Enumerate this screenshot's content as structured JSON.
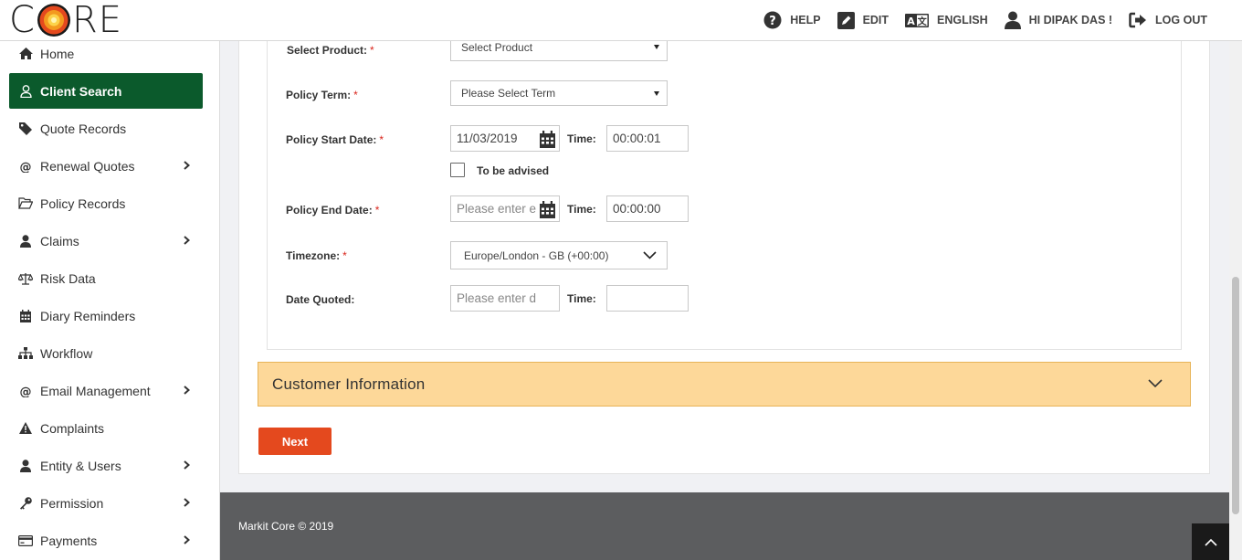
{
  "logo": {
    "letters": [
      "C",
      "R",
      "E"
    ]
  },
  "top_nav": [
    {
      "label": "HELP",
      "icon": "help-icon"
    },
    {
      "label": "EDIT",
      "icon": "edit-icon"
    },
    {
      "label": "ENGLISH",
      "icon": "translate-icon"
    },
    {
      "label": "HI DIPAK DAS !",
      "icon": "user-icon"
    },
    {
      "label": "LOG OUT",
      "icon": "logout-icon"
    }
  ],
  "sidebar": {
    "items": [
      {
        "label": "Home",
        "icon": "home-icon",
        "has_submenu": false
      },
      {
        "label": "Client Search",
        "icon": "user-outline-icon",
        "has_submenu": false,
        "active": true
      },
      {
        "label": "Quote Records",
        "icon": "tag-icon",
        "has_submenu": false
      },
      {
        "label": "Renewal Quotes",
        "icon": "at-icon",
        "has_submenu": true
      },
      {
        "label": "Policy Records",
        "icon": "folder-open-icon",
        "has_submenu": false
      },
      {
        "label": "Claims",
        "icon": "user-icon",
        "has_submenu": true
      },
      {
        "label": "Risk Data",
        "icon": "balance-scale-icon",
        "has_submenu": false
      },
      {
        "label": "Diary Reminders",
        "icon": "calendar-icon",
        "has_submenu": false
      },
      {
        "label": "Workflow",
        "icon": "sitemap-icon",
        "has_submenu": false
      },
      {
        "label": "Email Management",
        "icon": "at-icon",
        "has_submenu": true
      },
      {
        "label": "Complaints",
        "icon": "warning-icon",
        "has_submenu": false
      },
      {
        "label": "Entity & Users",
        "icon": "user-icon",
        "has_submenu": true
      },
      {
        "label": "Permission",
        "icon": "key-icon",
        "has_submenu": true
      },
      {
        "label": "Payments",
        "icon": "credit-card-icon",
        "has_submenu": true
      }
    ]
  },
  "form": {
    "product": {
      "label": "Select Product:",
      "value": "Select Product"
    },
    "policy_term": {
      "label": "Policy Term:",
      "value": "Please Select Term"
    },
    "start_date": {
      "label": "Policy Start Date:",
      "value": "11/03/2019",
      "time_label": "Time:",
      "time_value": "00:00:01"
    },
    "to_be_advised": {
      "label": "To be advised",
      "checked": false
    },
    "end_date": {
      "label": "Policy End Date:",
      "placeholder": "Please enter e",
      "time_label": "Time:",
      "time_value": "00:00:00"
    },
    "timezone": {
      "label": "Timezone:",
      "value": "Europe/London - GB (+00:00)"
    },
    "date_quoted": {
      "label": "Date Quoted:",
      "placeholder": "Please enter d",
      "time_label": "Time:",
      "time_value": ""
    },
    "required_mark": "*"
  },
  "accordion": {
    "title": "Customer Information"
  },
  "next_button": {
    "label": "Next"
  },
  "footer": {
    "text": "Markit Core © 2019"
  },
  "colors": {
    "active_menu": "#0b5a2c",
    "accordion_bg": "#fdd899",
    "next_button": "#e4491e",
    "footer_bg": "#5c5d5f",
    "required": "#d9251c"
  }
}
